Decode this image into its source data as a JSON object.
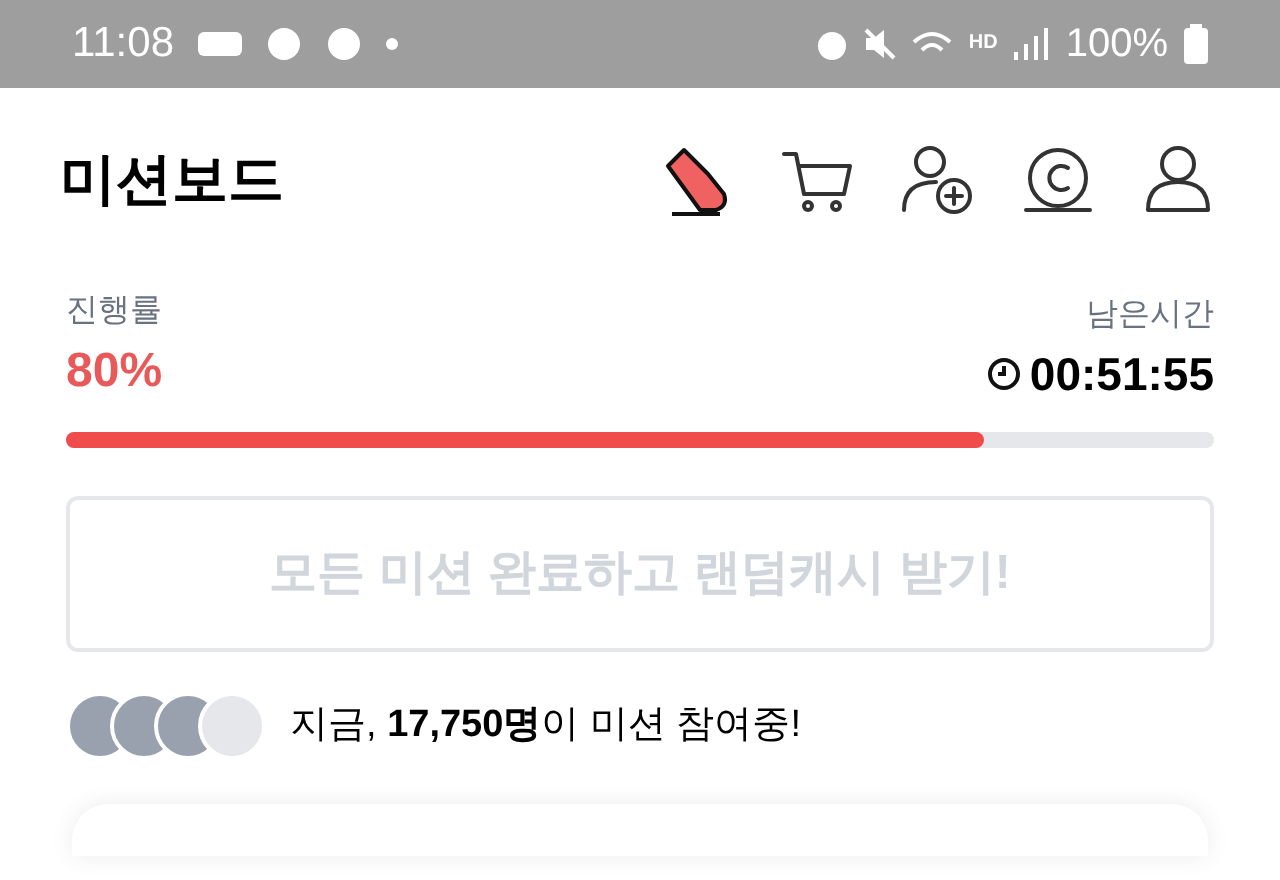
{
  "status_bar": {
    "time": "11:08",
    "network_badge": "HD",
    "battery": "100%"
  },
  "header": {
    "title": "미션보드"
  },
  "progress": {
    "label": "진행률",
    "value": "80%",
    "level": 0.8,
    "remaining_label": "남은시간",
    "remaining": "00:51:55"
  },
  "complete_button": {
    "label": "모든 미션 완료하고 랜덤캐시 받기!",
    "disabled": true
  },
  "participants": {
    "text": "지금, **17,750명**이 미션 참여중!",
    "avatars": [
      {
        "kind": "photo"
      },
      {
        "kind": "photo"
      },
      {
        "kind": "photo"
      },
      {
        "kind": "default"
      }
    ]
  }
}
